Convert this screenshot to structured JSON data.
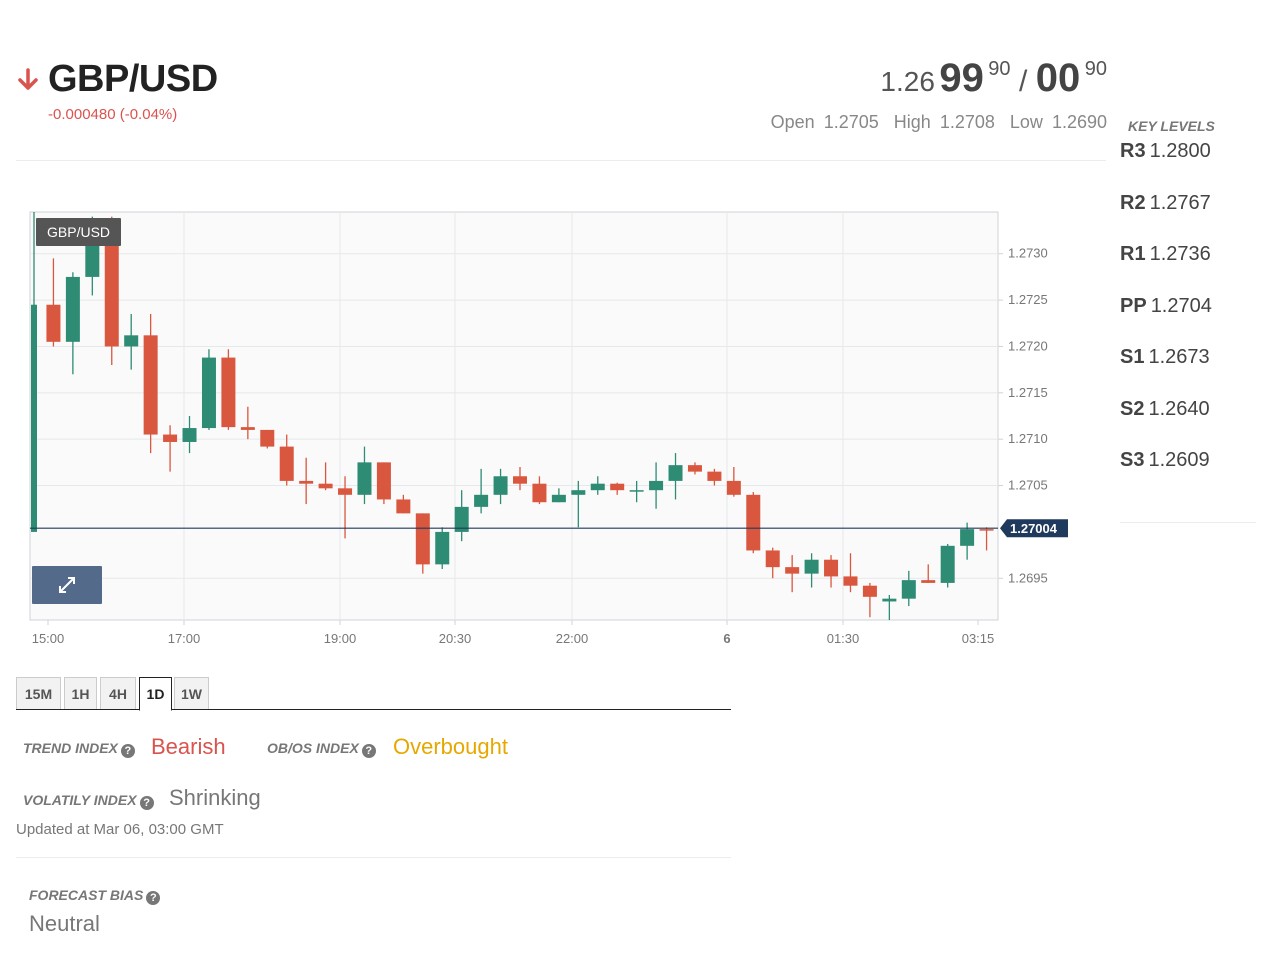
{
  "instrument": {
    "pair": "GBP/USD",
    "direction": "down",
    "change_text": "-0.000480 (-0.04%)",
    "arrow_color": "#d9534f"
  },
  "quote": {
    "bid_prefix": "1.26",
    "bid_big": "99",
    "bid_pip": "90",
    "separator": "/",
    "ask_big": "00",
    "ask_pip": "90"
  },
  "ohl": {
    "open_label": "Open",
    "open": "1.2705",
    "high_label": "High",
    "high": "1.2708",
    "low_label": "Low",
    "low": "1.2690"
  },
  "key_levels": {
    "title": "KEY LEVELS",
    "levels": [
      {
        "name": "R3",
        "value": "1.2800"
      },
      {
        "name": "R2",
        "value": "1.2767"
      },
      {
        "name": "R1",
        "value": "1.2736"
      },
      {
        "name": "PP",
        "value": "1.2704"
      },
      {
        "name": "S1",
        "value": "1.2673"
      },
      {
        "name": "S2",
        "value": "1.2640"
      },
      {
        "name": "S3",
        "value": "1.2609"
      }
    ]
  },
  "chart_data": {
    "type": "candlestick",
    "title": "GBP/USD",
    "ylim": [
      1.26905,
      1.27345
    ],
    "y_ticks": [
      "1.2730",
      "1.2725",
      "1.2720",
      "1.2715",
      "1.2710",
      "1.2705",
      "1.2695"
    ],
    "x_ticks": [
      "15:00",
      "17:00",
      "19:00",
      "20:30",
      "22:00",
      "6",
      "01:30",
      "03:15"
    ],
    "last_price": "1.27004",
    "up_color": "#2e8b74",
    "down_color": "#d9573f",
    "candles": [
      {
        "o": 1.27,
        "h": 1.27345,
        "l": 1.27,
        "c": 1.27245
      },
      {
        "o": 1.27245,
        "h": 1.27295,
        "l": 1.272,
        "c": 1.27205
      },
      {
        "o": 1.27205,
        "h": 1.2728,
        "l": 1.2717,
        "c": 1.27275
      },
      {
        "o": 1.27275,
        "h": 1.2734,
        "l": 1.27255,
        "c": 1.2733
      },
      {
        "o": 1.2733,
        "h": 1.2734,
        "l": 1.2718,
        "c": 1.272
      },
      {
        "o": 1.272,
        "h": 1.27235,
        "l": 1.27175,
        "c": 1.27212
      },
      {
        "o": 1.27212,
        "h": 1.27235,
        "l": 1.27085,
        "c": 1.27105
      },
      {
        "o": 1.27105,
        "h": 1.27115,
        "l": 1.27065,
        "c": 1.27097
      },
      {
        "o": 1.27097,
        "h": 1.27125,
        "l": 1.27085,
        "c": 1.27112
      },
      {
        "o": 1.27112,
        "h": 1.27197,
        "l": 1.2711,
        "c": 1.27188
      },
      {
        "o": 1.27188,
        "h": 1.27197,
        "l": 1.2711,
        "c": 1.27113
      },
      {
        "o": 1.27113,
        "h": 1.27135,
        "l": 1.271,
        "c": 1.2711
      },
      {
        "o": 1.2711,
        "h": 1.2711,
        "l": 1.2709,
        "c": 1.27092
      },
      {
        "o": 1.27092,
        "h": 1.27105,
        "l": 1.2705,
        "c": 1.27055
      },
      {
        "o": 1.27055,
        "h": 1.2708,
        "l": 1.2703,
        "c": 1.27052
      },
      {
        "o": 1.27052,
        "h": 1.27075,
        "l": 1.27045,
        "c": 1.27047
      },
      {
        "o": 1.27047,
        "h": 1.2706,
        "l": 1.26993,
        "c": 1.2704
      },
      {
        "o": 1.2704,
        "h": 1.27092,
        "l": 1.2703,
        "c": 1.27075
      },
      {
        "o": 1.27075,
        "h": 1.27075,
        "l": 1.2703,
        "c": 1.27035
      },
      {
        "o": 1.27035,
        "h": 1.2704,
        "l": 1.2702,
        "c": 1.2702
      },
      {
        "o": 1.2702,
        "h": 1.2702,
        "l": 1.26955,
        "c": 1.26965
      },
      {
        "o": 1.26965,
        "h": 1.27005,
        "l": 1.2696,
        "c": 1.27
      },
      {
        "o": 1.27,
        "h": 1.27045,
        "l": 1.2699,
        "c": 1.27027
      },
      {
        "o": 1.27027,
        "h": 1.27068,
        "l": 1.2702,
        "c": 1.2704
      },
      {
        "o": 1.2704,
        "h": 1.27068,
        "l": 1.2703,
        "c": 1.2706
      },
      {
        "o": 1.2706,
        "h": 1.2707,
        "l": 1.27045,
        "c": 1.27052
      },
      {
        "o": 1.27052,
        "h": 1.2706,
        "l": 1.2703,
        "c": 1.27032
      },
      {
        "o": 1.27032,
        "h": 1.27047,
        "l": 1.27032,
        "c": 1.2704
      },
      {
        "o": 1.2704,
        "h": 1.27055,
        "l": 1.27005,
        "c": 1.27045
      },
      {
        "o": 1.27045,
        "h": 1.2706,
        "l": 1.2704,
        "c": 1.27052
      },
      {
        "o": 1.27052,
        "h": 1.27053,
        "l": 1.2704,
        "c": 1.27045
      },
      {
        "o": 1.27045,
        "h": 1.27055,
        "l": 1.27032,
        "c": 1.27045
      },
      {
        "o": 1.27045,
        "h": 1.27075,
        "l": 1.27025,
        "c": 1.27055
      },
      {
        "o": 1.27055,
        "h": 1.27085,
        "l": 1.27035,
        "c": 1.27072
      },
      {
        "o": 1.27072,
        "h": 1.27075,
        "l": 1.27062,
        "c": 1.27065
      },
      {
        "o": 1.27065,
        "h": 1.27068,
        "l": 1.2705,
        "c": 1.27055
      },
      {
        "o": 1.27055,
        "h": 1.2707,
        "l": 1.27038,
        "c": 1.2704
      },
      {
        "o": 1.2704,
        "h": 1.27043,
        "l": 1.26977,
        "c": 1.2698
      },
      {
        "o": 1.2698,
        "h": 1.26983,
        "l": 1.2695,
        "c": 1.26962
      },
      {
        "o": 1.26962,
        "h": 1.26975,
        "l": 1.26935,
        "c": 1.26955
      },
      {
        "o": 1.26955,
        "h": 1.26977,
        "l": 1.2694,
        "c": 1.2697
      },
      {
        "o": 1.2697,
        "h": 1.26975,
        "l": 1.2694,
        "c": 1.26952
      },
      {
        "o": 1.26952,
        "h": 1.26977,
        "l": 1.26935,
        "c": 1.26942
      },
      {
        "o": 1.26942,
        "h": 1.26945,
        "l": 1.26908,
        "c": 1.2693
      },
      {
        "o": 1.26925,
        "h": 1.26932,
        "l": 1.26905,
        "c": 1.26928
      },
      {
        "o": 1.26928,
        "h": 1.26958,
        "l": 1.2692,
        "c": 1.26948
      },
      {
        "o": 1.26948,
        "h": 1.26965,
        "l": 1.26945,
        "c": 1.26945
      },
      {
        "o": 1.26945,
        "h": 1.26987,
        "l": 1.2694,
        "c": 1.26985
      },
      {
        "o": 1.26985,
        "h": 1.2701,
        "l": 1.2697,
        "c": 1.27003
      },
      {
        "o": 1.27003,
        "h": 1.27005,
        "l": 1.2698,
        "c": 1.27002
      }
    ]
  },
  "chart_ui": {
    "pair_tag": "GBP/USD",
    "expand_icon": "expand-arrows-icon"
  },
  "timeframes": {
    "tabs": [
      "15M",
      "1H",
      "4H",
      "1D",
      "1W"
    ],
    "active": "1D"
  },
  "indicators": {
    "trend_label": "TREND INDEX",
    "trend_value": "Bearish",
    "obos_label": "OB/OS INDEX",
    "obos_value": "Overbought",
    "volatility_label": "VOLATILY INDEX",
    "volatility_value": "Shrinking",
    "help_icon": "?",
    "updated": "Updated at Mar 06, 03:00 GMT",
    "forecast_label": "FORECAST BIAS",
    "forecast_value": "Neutral",
    "colors": {
      "bearish": "#d9534f",
      "overbought": "#e6a800",
      "neutral": "#777777"
    }
  }
}
